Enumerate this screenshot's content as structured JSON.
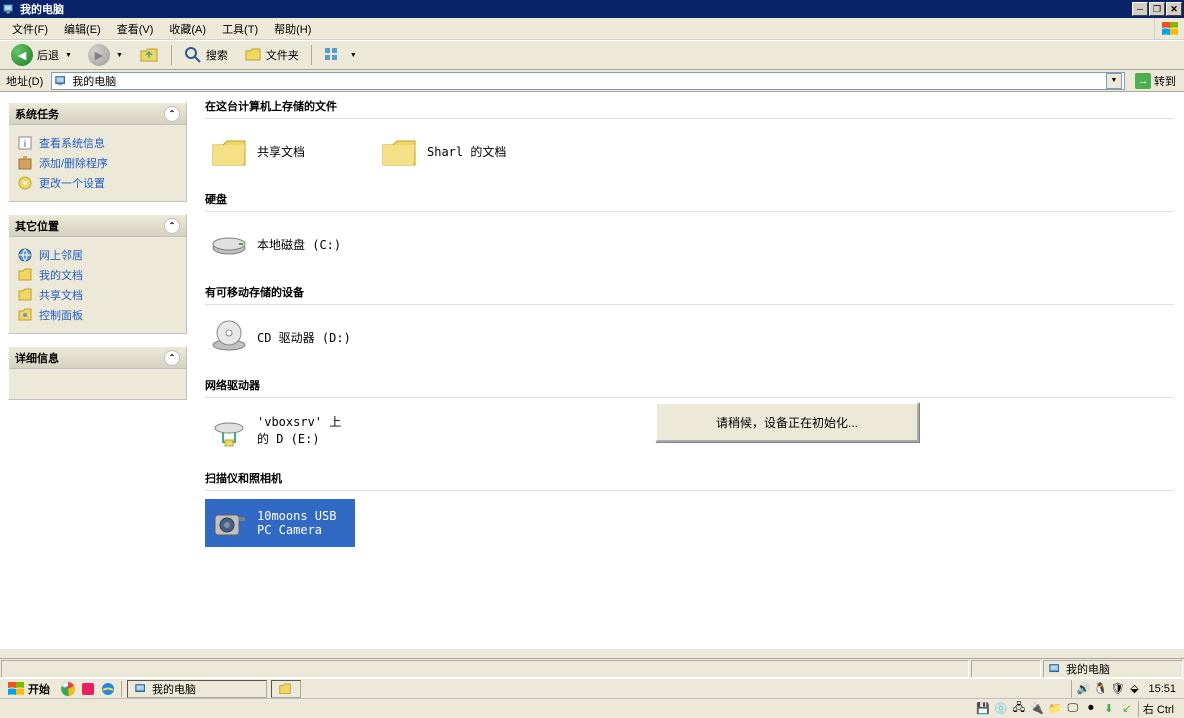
{
  "window": {
    "title": "我的电脑"
  },
  "menu": {
    "file": "文件(F)",
    "edit": "编辑(E)",
    "view": "查看(V)",
    "favorites": "收藏(A)",
    "tools": "工具(T)",
    "help": "帮助(H)"
  },
  "toolbar": {
    "back": "后退",
    "search": "搜索",
    "folders": "文件夹"
  },
  "address": {
    "label": "地址(D)",
    "value": "我的电脑",
    "go": "转到"
  },
  "sidebar": {
    "panels": [
      {
        "title": "系统任务",
        "links": [
          {
            "label": "查看系统信息",
            "icon": "info"
          },
          {
            "label": "添加/删除程序",
            "icon": "addremove"
          },
          {
            "label": "更改一个设置",
            "icon": "settings"
          }
        ]
      },
      {
        "title": "其它位置",
        "links": [
          {
            "label": "网上邻居",
            "icon": "network"
          },
          {
            "label": "我的文档",
            "icon": "mydocs"
          },
          {
            "label": "共享文档",
            "icon": "shared"
          },
          {
            "label": "控制面板",
            "icon": "cpanel"
          }
        ]
      },
      {
        "title": "详细信息",
        "links": []
      }
    ]
  },
  "content": {
    "sections": [
      {
        "title": "在这台计算机上存储的文件",
        "items": [
          {
            "label": "共享文档",
            "icon": "folder"
          },
          {
            "label": "Sharl 的文档",
            "icon": "folder"
          }
        ]
      },
      {
        "title": "硬盘",
        "items": [
          {
            "label": "本地磁盘 (C:)",
            "icon": "hdd"
          }
        ]
      },
      {
        "title": "有可移动存储的设备",
        "items": [
          {
            "label": "CD 驱动器 (D:)",
            "icon": "cd"
          }
        ]
      },
      {
        "title": "网络驱动器",
        "items": [
          {
            "label": "'vboxsrv' 上的 D (E:)",
            "icon": "netdrive"
          }
        ]
      },
      {
        "title": "扫描仪和照相机",
        "items": [
          {
            "label": "10moons USB PC Camera",
            "icon": "camera",
            "selected": true
          }
        ]
      }
    ]
  },
  "dialog": {
    "message": "请稍候，设备正在初始化..."
  },
  "statusbar": {
    "right_label": "我的电脑"
  },
  "taskbar": {
    "start": "开始",
    "tasks": [
      {
        "label": "我的电脑"
      },
      {
        "label": ""
      }
    ],
    "clock": "15:51"
  },
  "vm": {
    "key": "右 Ctrl"
  }
}
